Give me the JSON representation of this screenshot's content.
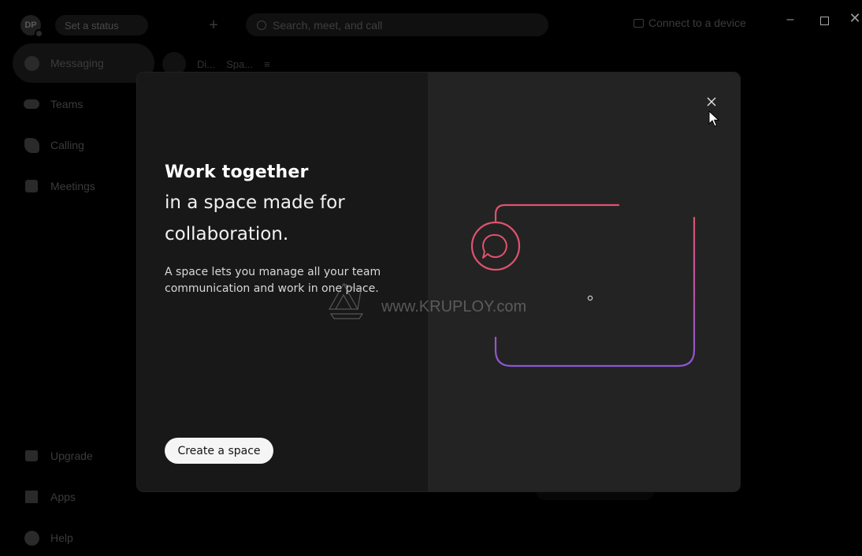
{
  "topbar": {
    "avatar_initials": "DP",
    "status_label": "Set a status",
    "add_label": "+",
    "search_placeholder": "Search, meet, and call",
    "connect_label": "Connect to a device",
    "window_minimize": "–",
    "window_close": "✕"
  },
  "sidebar": {
    "items": [
      {
        "label": "Messaging",
        "icon": "chat-bubble-icon"
      },
      {
        "label": "Teams",
        "icon": "people-icon"
      },
      {
        "label": "Calling",
        "icon": "phone-icon"
      },
      {
        "label": "Meetings",
        "icon": "calendar-icon"
      }
    ],
    "bottom_items": [
      {
        "label": "Upgrade",
        "icon": "crown-icon"
      },
      {
        "label": "Apps",
        "icon": "apps-grid-icon"
      },
      {
        "label": "Help",
        "icon": "help-icon"
      }
    ]
  },
  "conversation_tabs": {
    "direct_label": "Di...",
    "spaces_label": "Spa...",
    "filter_label": "≡"
  },
  "modal": {
    "heading_bold": "Work together",
    "heading_line2": "in a space made for",
    "heading_line3": "collaboration.",
    "description": "A space lets you manage all your team communication and work in one place.",
    "create_button_label": "Create a space",
    "close_icon": "close-icon"
  },
  "watermark": {
    "text": "www.KRUPLOY.com"
  },
  "colors": {
    "modal_left_bg": "#181818",
    "modal_right_bg": "#232323",
    "illustration_pink": "#e0526e",
    "illustration_purple": "#8e55d6",
    "button_bg": "#f5f5f5"
  }
}
